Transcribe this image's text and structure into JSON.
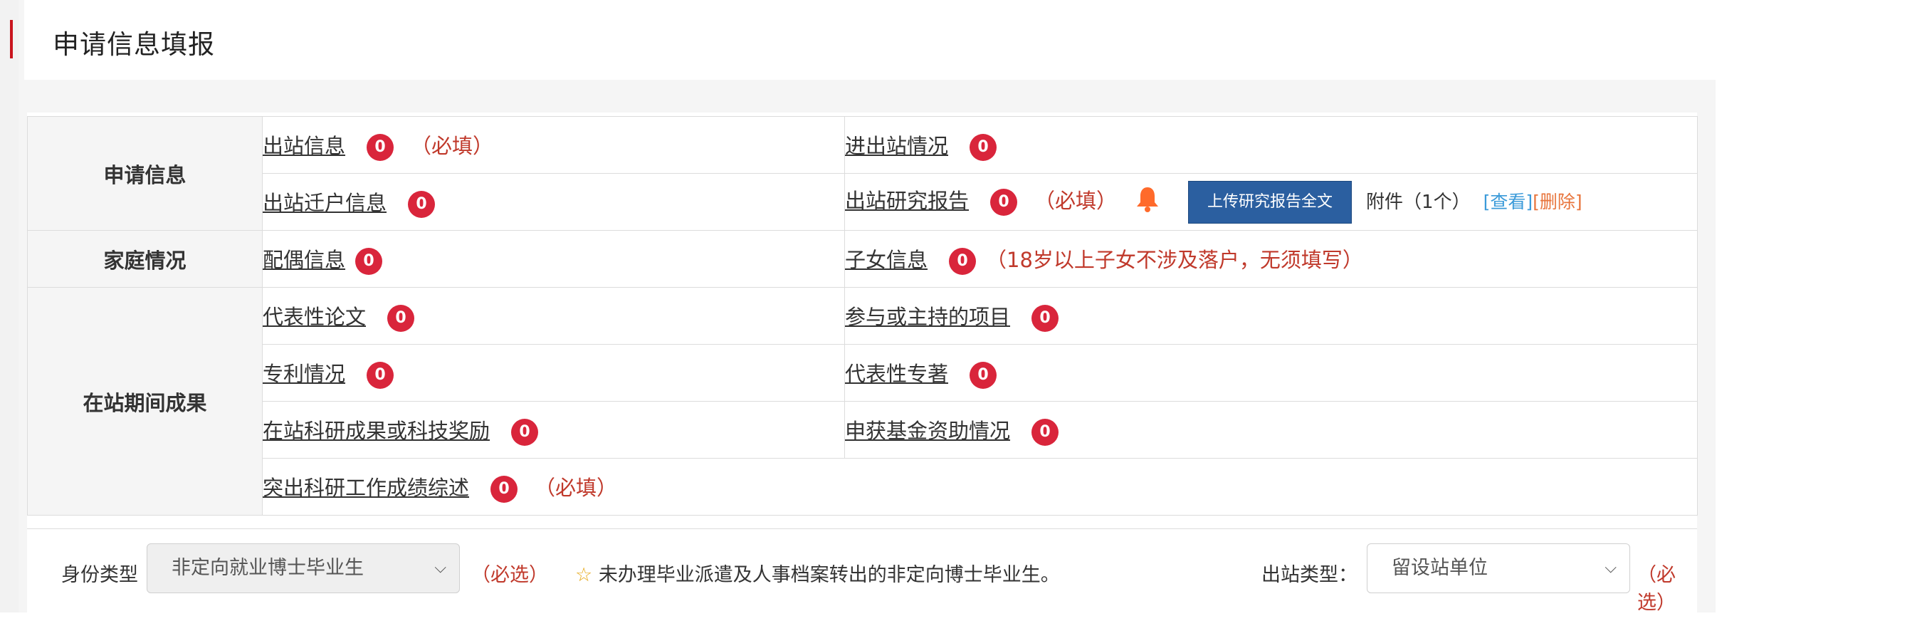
{
  "page_title": "申请信息填报",
  "required_text": "（必填）",
  "select_required_text": "（必选）",
  "categories": {
    "apply_info": "申请信息",
    "family": "家庭情况",
    "achievements": "在站期间成果"
  },
  "items": {
    "exit_info": {
      "label": "出站信息",
      "count": "0"
    },
    "in_out_status": {
      "label": "进出站情况",
      "count": "0"
    },
    "hukou_transfer": {
      "label": "出站迁户信息",
      "count": "0"
    },
    "research_report": {
      "label": "出站研究报告",
      "count": "0"
    },
    "spouse": {
      "label": "配偶信息",
      "count": "0"
    },
    "children": {
      "label": "子女信息",
      "count": "0",
      "note": "（18岁以上子女不涉及落户，无须填写）"
    },
    "papers": {
      "label": "代表性论文",
      "count": "0"
    },
    "projects": {
      "label": "参与或主持的项目",
      "count": "0"
    },
    "patents": {
      "label": "专利情况",
      "count": "0"
    },
    "monographs": {
      "label": "代表性专著",
      "count": "0"
    },
    "awards": {
      "label": "在站科研成果或科技奖励",
      "count": "0"
    },
    "funding": {
      "label": "申获基金资助情况",
      "count": "0"
    },
    "summary": {
      "label": "突出科研工作成绩综述",
      "count": "0"
    }
  },
  "report_actions": {
    "upload_button": "上传研究报告全文",
    "attachment": "附件（1个）",
    "view": "[查看]",
    "delete": "[删除]"
  },
  "identity": {
    "label": "身份类型",
    "selected": "非定向就业博士毕业生",
    "note": "未办理毕业派遣及人事档案转出的非定向博士毕业生。"
  },
  "exit_type": {
    "label": "出站类型：",
    "selected": "留设站单位"
  },
  "colors": {
    "badge": "#d9253b",
    "required": "#c0392b",
    "upload_button": "#2b5fa0",
    "view_link": "#3a9ad9",
    "delete_link": "#e8743b",
    "bell": "#ff6a2b"
  }
}
